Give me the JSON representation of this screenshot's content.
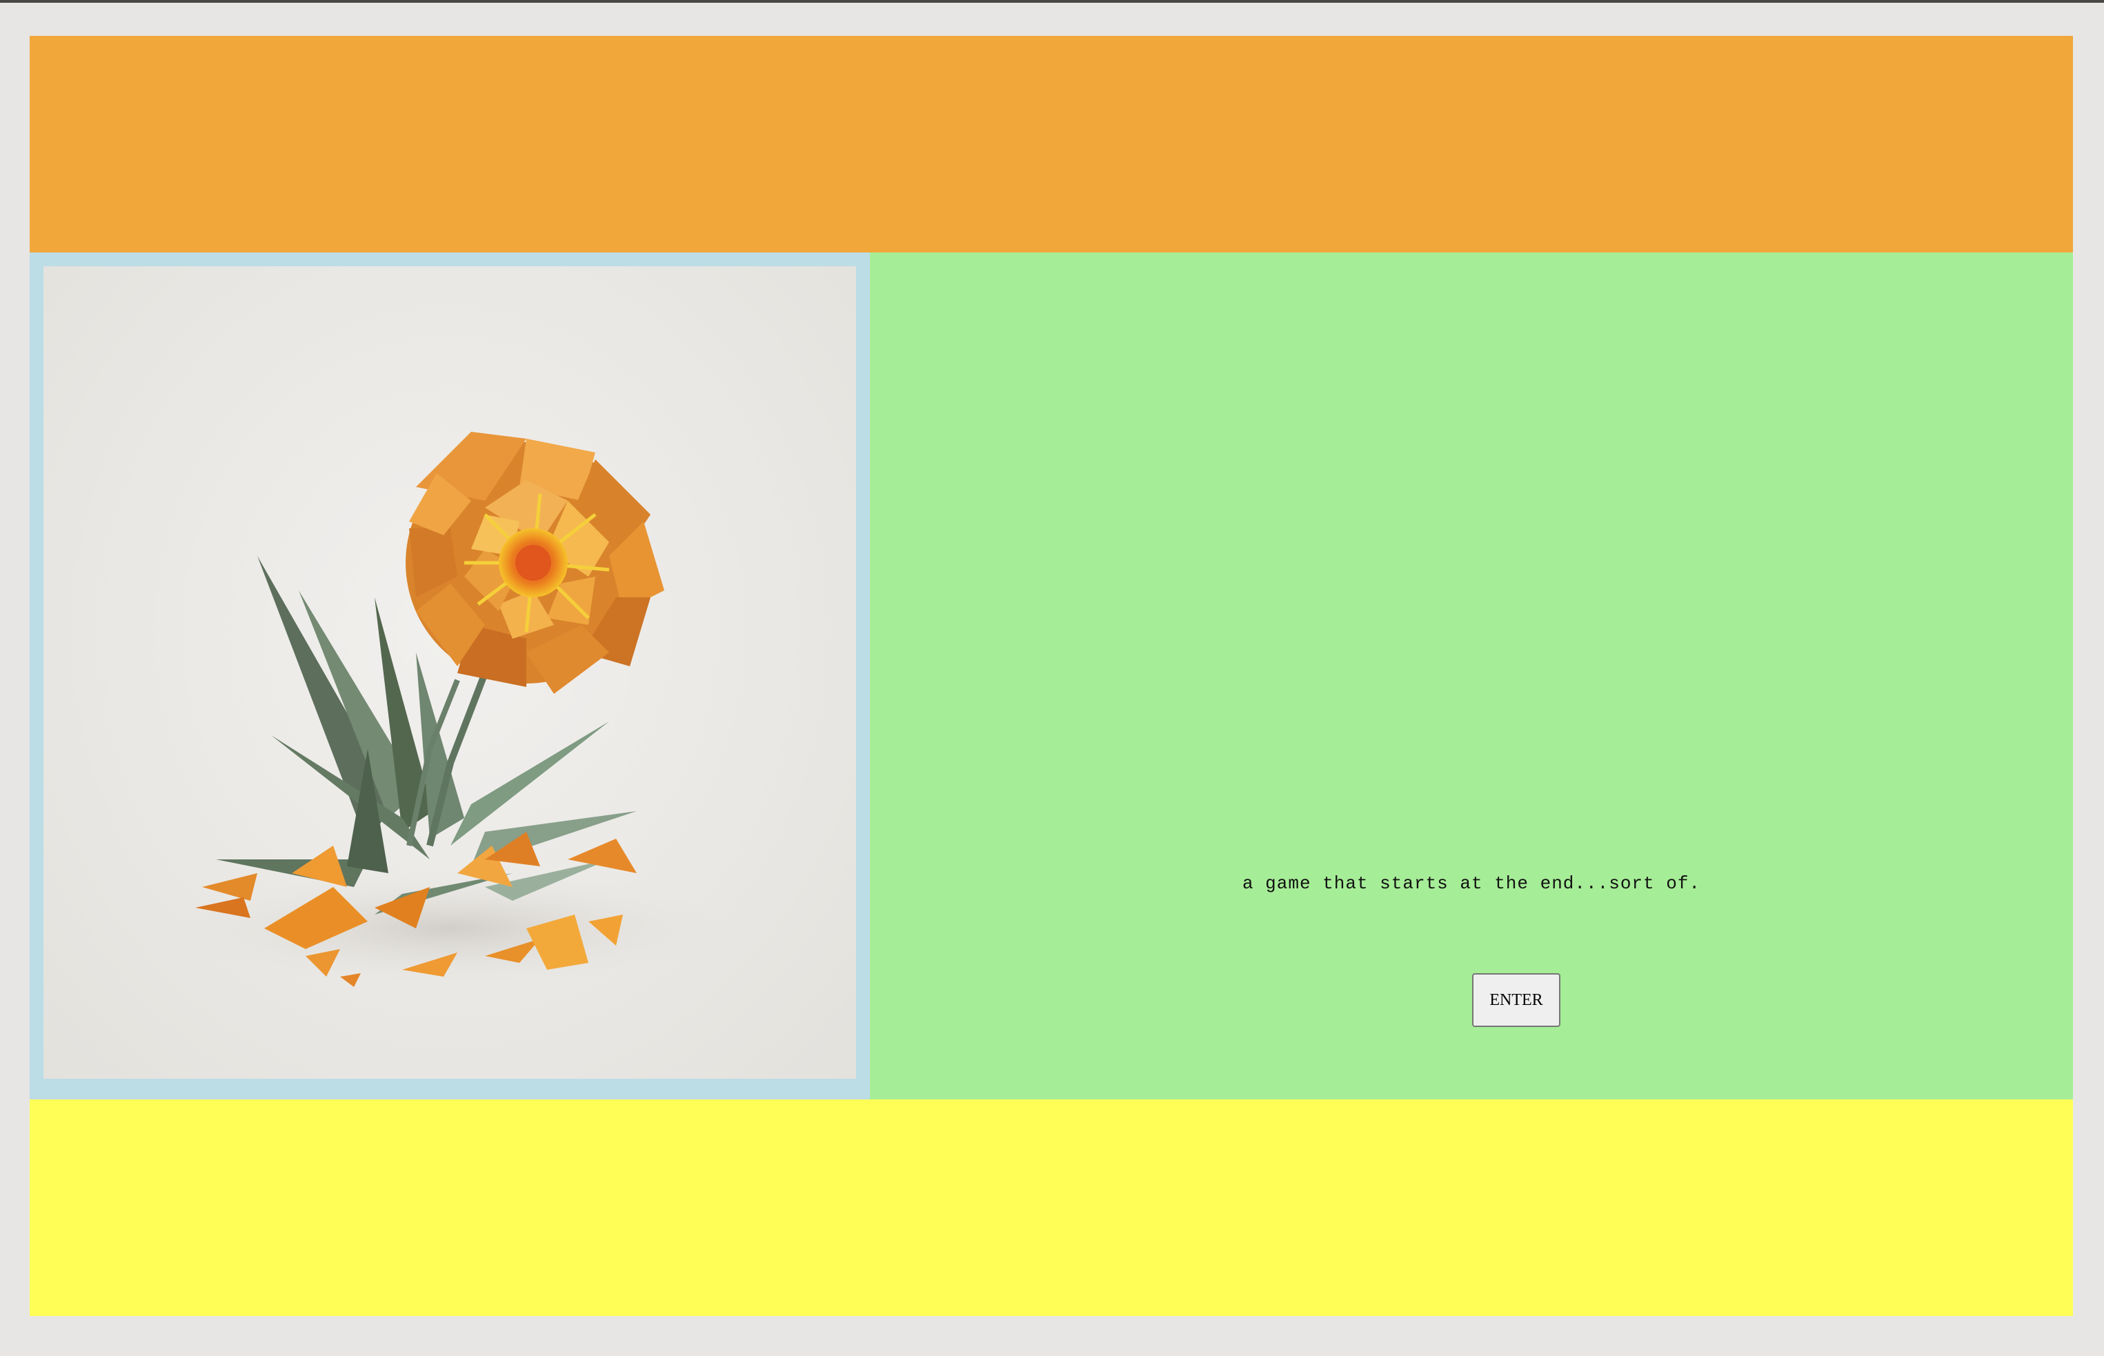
{
  "intro": {
    "tagline": "a game that starts at the end...sort of.",
    "enter_label": "ENTER"
  },
  "image": {
    "subject": "origami-marigold-illustration"
  },
  "colors": {
    "header": "#f2a73a",
    "content_panel": "#a6ed97",
    "image_border": "#bcdce6",
    "footer": "#fffe56",
    "page_background": "#e7e6e4"
  }
}
